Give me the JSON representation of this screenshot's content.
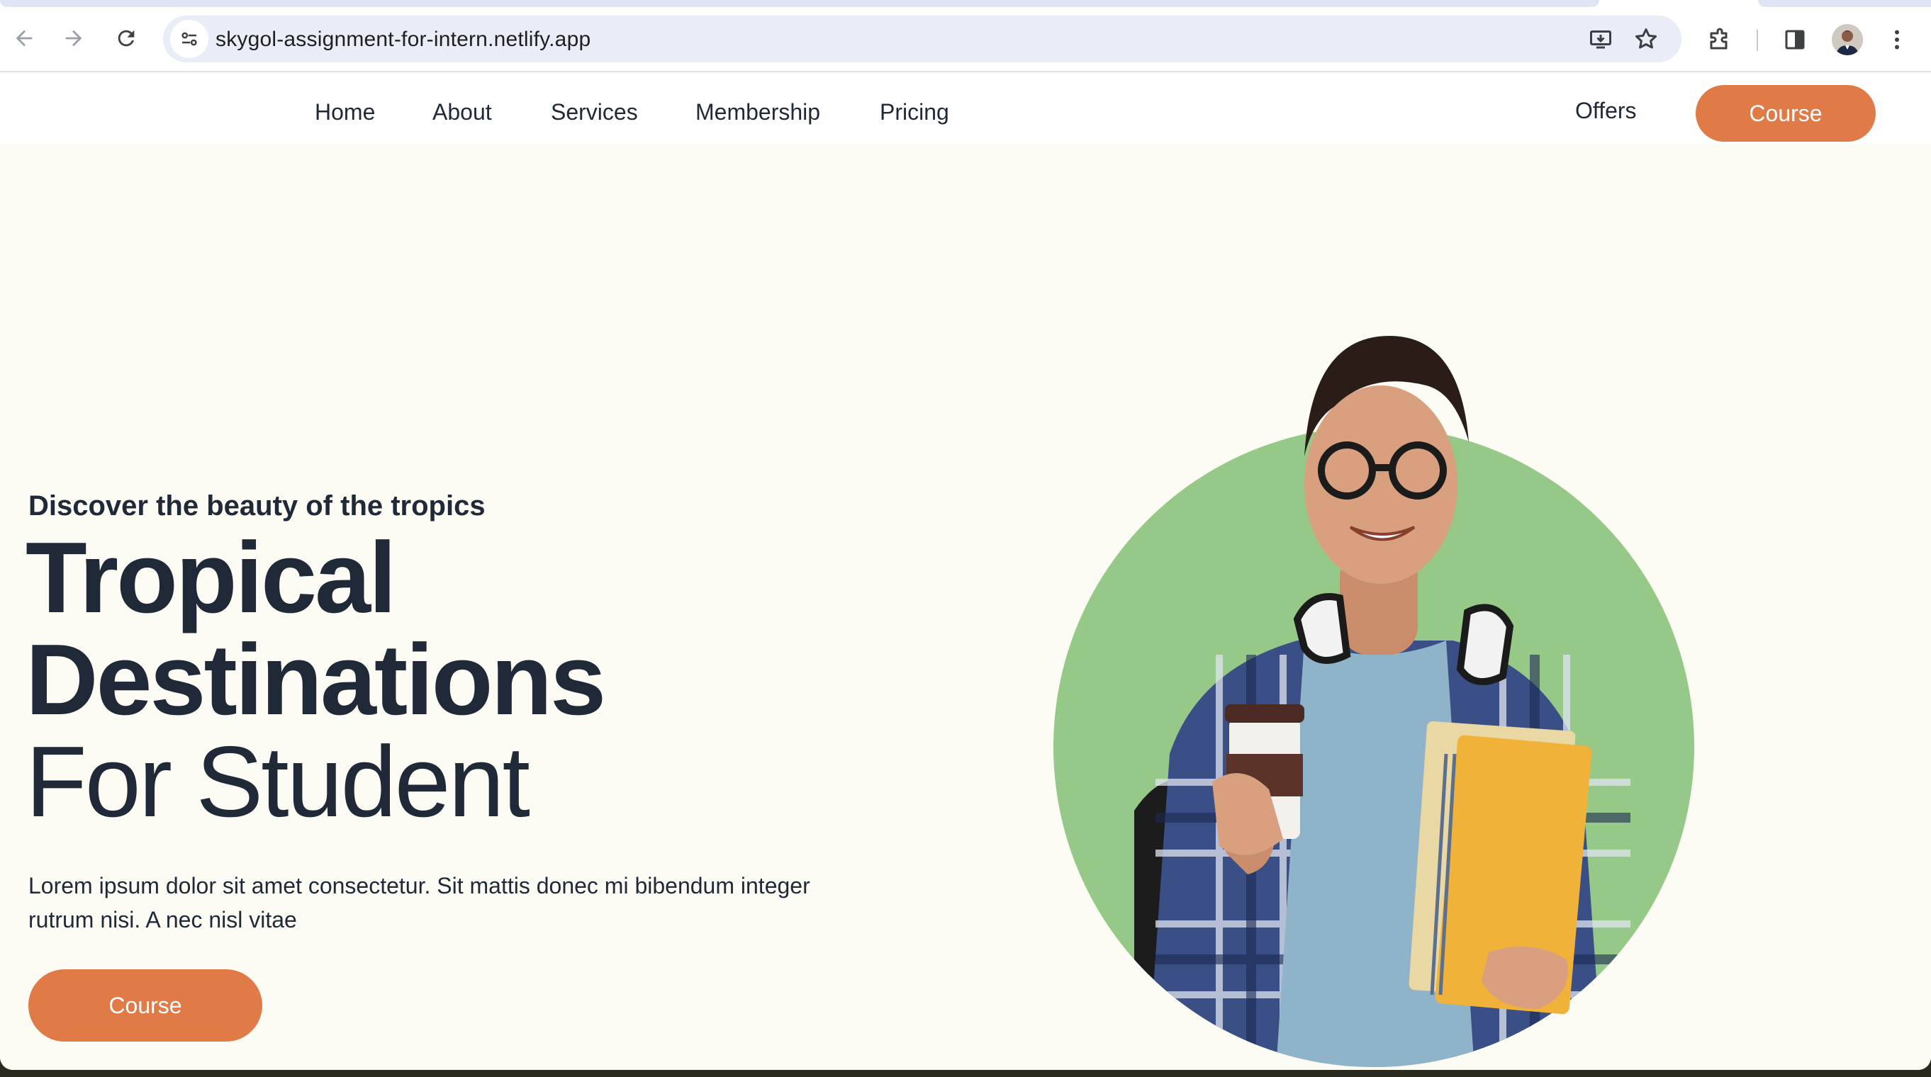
{
  "browser": {
    "url": "skygol-assignment-for-intern.netlify.app",
    "icons": [
      "back-icon",
      "forward-icon",
      "reload-icon",
      "site-info-icon",
      "install-app-icon",
      "bookmark-star-icon",
      "extensions-icon",
      "side-panel-icon",
      "profile-avatar",
      "more-menu-icon"
    ]
  },
  "header": {
    "menu": [
      {
        "label": "Home"
      },
      {
        "label": "About"
      },
      {
        "label": "Services"
      },
      {
        "label": "Membership"
      },
      {
        "label": "Pricing"
      }
    ],
    "offers_label": "Offers",
    "course_label": "Course"
  },
  "hero": {
    "eyebrow": "Discover the beauty of the tropics",
    "title_line1": "Tropical",
    "title_line2": "Destinations",
    "title_line3": "For Student",
    "description": "Lorem ipsum dolor sit amet consectetur. Sit mattis donec mi bibendum integer rutrum nisi. A nec nisl vitae",
    "cta_label": "Course",
    "image_alt": "Student with glasses, headphones, coffee cup and notebooks"
  },
  "colors": {
    "accent": "#e07b47",
    "page_bg": "#fcfbf4",
    "circle_green": "#96c987",
    "text_dark": "#1f2937"
  }
}
